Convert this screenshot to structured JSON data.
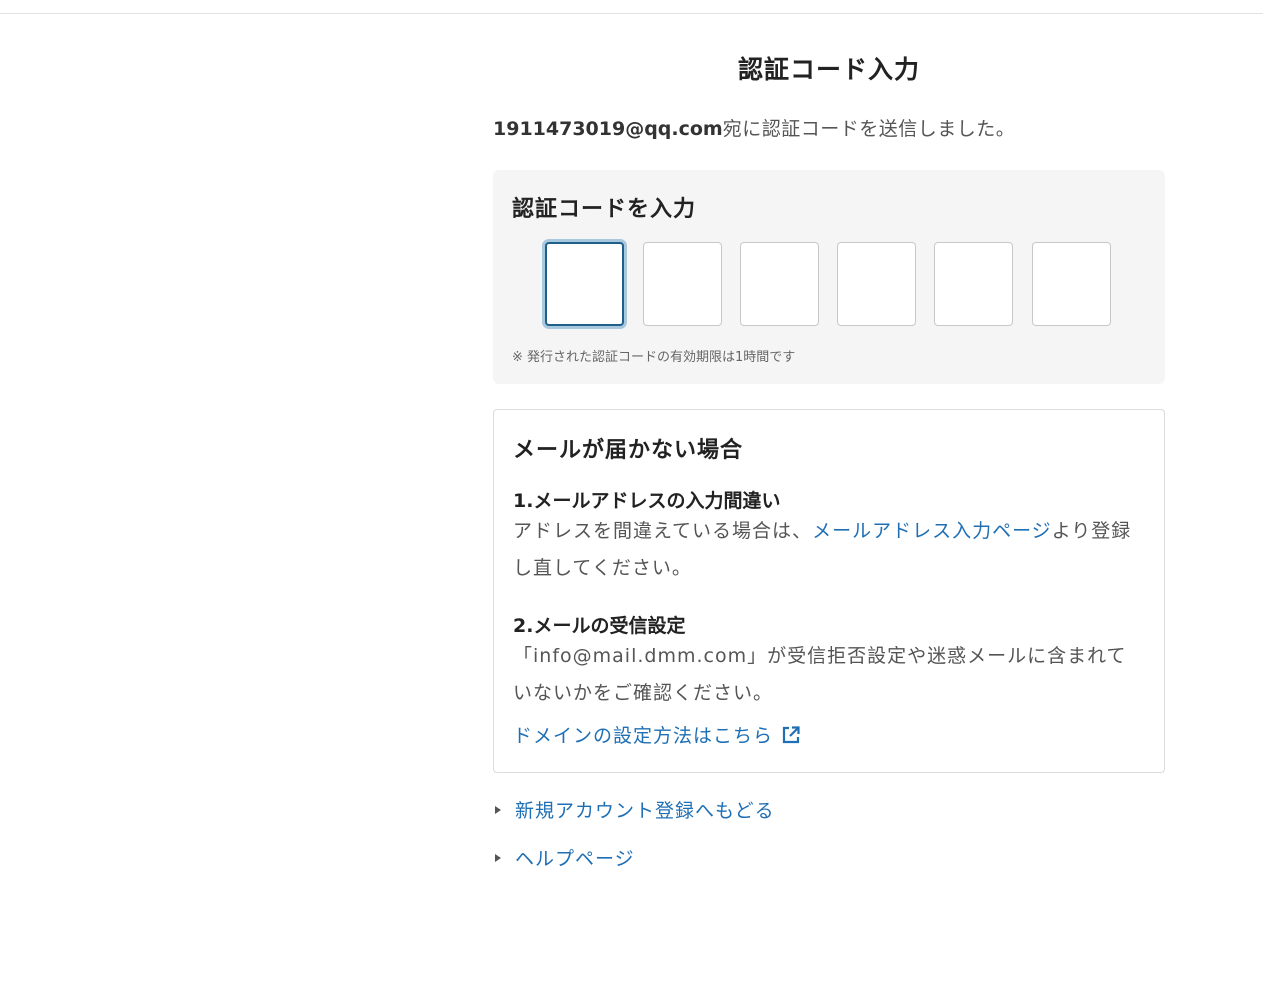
{
  "page": {
    "title": "認証コード入力",
    "email": "1911473019@qq.com",
    "sent_suffix": "宛に認証コードを送信しました。"
  },
  "code_panel": {
    "title": "認証コードを入力",
    "digits": [
      "",
      "",
      "",
      "",
      "",
      ""
    ],
    "note": "※ 発行された認証コードの有効期限は1時間です"
  },
  "help": {
    "title": "メールが届かない場合",
    "item1": {
      "heading": "1.メールアドレスの入力間違い",
      "text_before": "アドレスを間違えている場合は、",
      "link": "メールアドレス入力ページ",
      "text_after": "より登録し直してください。"
    },
    "item2": {
      "heading": "2.メールの受信設定",
      "text": "「info@mail.dmm.com」が受信拒否設定や迷惑メールに含まれていないかをご確認ください。",
      "domain_link": "ドメインの設定方法はこちら"
    }
  },
  "nav": {
    "back_signup": "新規アカウント登録へもどる",
    "help_page": "ヘルプページ"
  },
  "icons": {
    "external": "external-link-icon",
    "nav_marker": "triangle-right-icon"
  },
  "colors": {
    "link": "#1f6fb5",
    "focus_border": "#1f5f8b",
    "panel_bg": "#f5f5f5"
  }
}
